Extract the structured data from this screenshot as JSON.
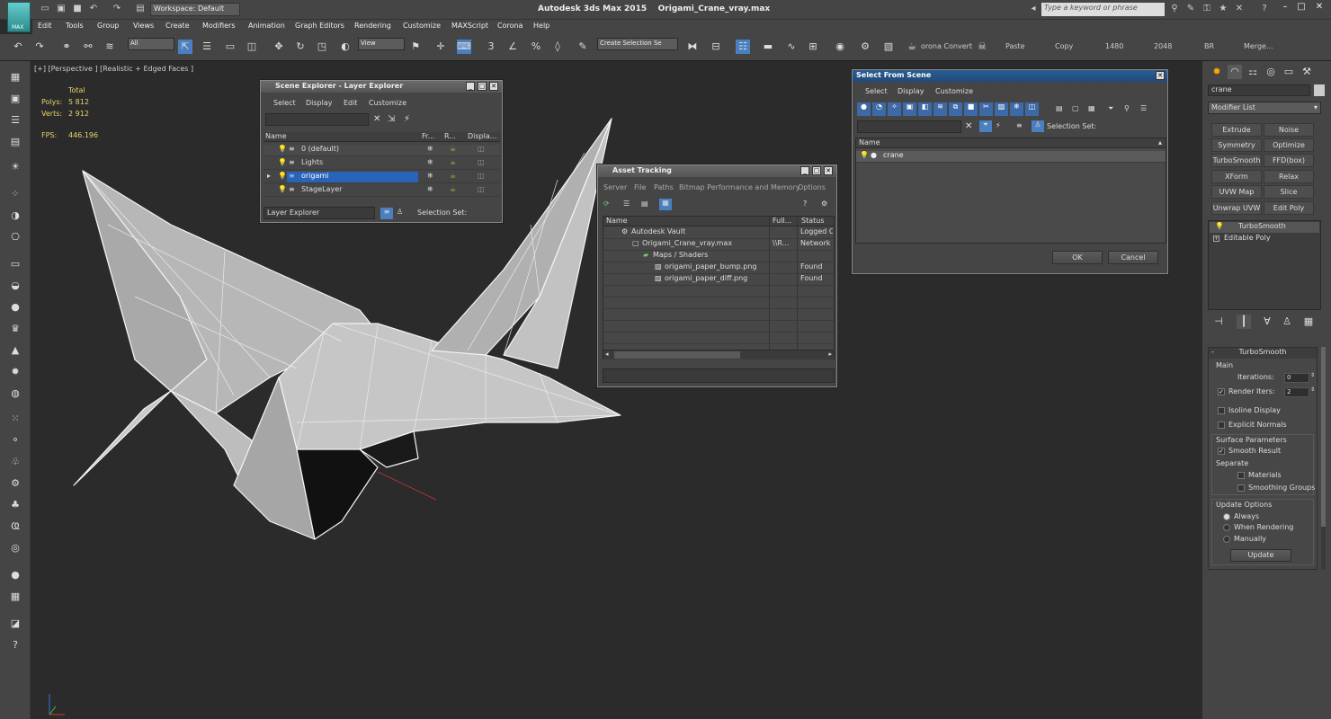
{
  "app": {
    "title": "Autodesk 3ds Max  2015",
    "filename": "Origami_Crane_vray.max",
    "logo_label": "MAX",
    "workspace": "Workspace: Default",
    "search_placeholder": "Type a keyword or phrase"
  },
  "menus": [
    "Edit",
    "Tools",
    "Group",
    "Views",
    "Create",
    "Modifiers",
    "Animation",
    "Graph Editors",
    "Rendering",
    "Customize",
    "MAXScript",
    "Corona",
    "Help"
  ],
  "toolbar": {
    "filter": "All",
    "view": "View",
    "snap_num": "3",
    "named_set": "Create Selection Se",
    "corona_convert": "orona Convert",
    "paste": "Paste",
    "copy": "Copy",
    "width": "1480",
    "height": "2048",
    "br": "BR",
    "merge": "Merge..."
  },
  "viewport": {
    "label": "[+] [Perspective ] [Realistic + Edged Faces ]",
    "total_label": "Total",
    "polys_label": "Polys:",
    "polys_value": "5 812",
    "verts_label": "Verts:",
    "verts_value": "2 912",
    "fps_label": "FPS:",
    "fps_value": "446.196"
  },
  "scene_explorer": {
    "title": "Scene Explorer - Layer Explorer",
    "menus": [
      "Select",
      "Display",
      "Edit",
      "Customize"
    ],
    "columns": [
      "Name",
      "Fr...",
      "R...",
      "Displa..."
    ],
    "layers": [
      {
        "name": "0 (default)",
        "selected": false
      },
      {
        "name": "Lights",
        "selected": false
      },
      {
        "name": "origami",
        "selected": true
      },
      {
        "name": "StageLayer",
        "selected": false
      }
    ],
    "footer_dropdown": "Layer Explorer",
    "footer_selection": "Selection Set:"
  },
  "asset_tracking": {
    "title": "Asset Tracking",
    "menus": [
      "Server",
      "File",
      "Paths",
      "Bitmap Performance and Memory",
      "Options"
    ],
    "columns": [
      "Name",
      "Full...",
      "Status"
    ],
    "rows": [
      {
        "indent": 1,
        "name": "Autodesk Vault",
        "full": "",
        "status": "Logged Ou"
      },
      {
        "indent": 2,
        "name": "Origami_Crane_vray.max",
        "full": "\\\\R...",
        "status": "Network P"
      },
      {
        "indent": 3,
        "name": "Maps / Shaders",
        "full": "",
        "status": ""
      },
      {
        "indent": 4,
        "name": "origami_paper_bump.png",
        "full": "",
        "status": "Found"
      },
      {
        "indent": 4,
        "name": "origami_paper_diff.png",
        "full": "",
        "status": "Found"
      }
    ]
  },
  "select_from_scene": {
    "title": "Select From Scene",
    "menus": [
      "Select",
      "Display",
      "Customize"
    ],
    "column": "Name",
    "selection_set": "Selection Set:",
    "item": "crane",
    "ok": "OK",
    "cancel": "Cancel"
  },
  "command_panel": {
    "object_name": "crane",
    "modifier_list": "Modifier List",
    "buttons": [
      "Extrude",
      "Noise",
      "Symmetry",
      "Optimize",
      "TurboSmooth",
      "FFD(box)",
      "XForm",
      "Relax",
      "UVW Map",
      "Slice",
      "Unwrap UVW",
      "Edit Poly"
    ],
    "stack": [
      "TurboSmooth",
      "Editable Poly"
    ],
    "rollout_title": "TurboSmooth",
    "main": "Main",
    "iterations_label": "Iterations:",
    "iterations_value": "0",
    "render_iters_label": "Render Iters:",
    "render_iters_value": "2",
    "isoline": "Isoline Display",
    "explicit_normals": "Explicit Normals",
    "surface_params": "Surface Parameters",
    "smooth_result": "Smooth Result",
    "separate": "Separate",
    "materials": "Materials",
    "smoothing_groups": "Smoothing Groups",
    "update_options": "Update Options",
    "always": "Always",
    "when_rendering": "When Rendering",
    "manually": "Manually",
    "update": "Update"
  }
}
